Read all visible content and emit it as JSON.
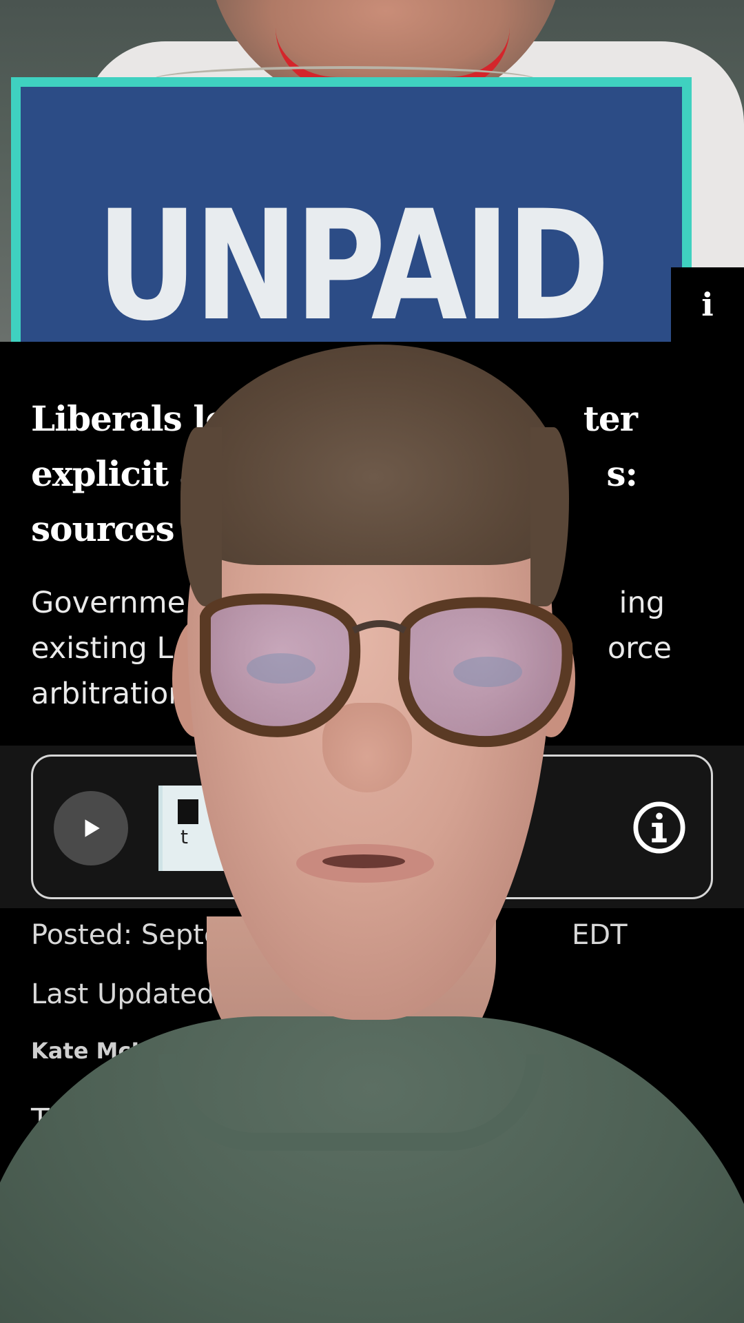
{
  "hero": {
    "sign_text": "UNPAID",
    "info_tab_label": "i"
  },
  "article": {
    "headline_lines": [
      "Liberals lo",
      "explicit a",
      "sources"
    ],
    "headline_right_fragments": [
      "ter",
      "s:"
    ],
    "summary_lines": [
      "Governme",
      "existing L",
      "arbitration"
    ],
    "summary_right_fragments": [
      "ing",
      "orce"
    ],
    "posted": "Posted: Septe",
    "posted_right": "EDT",
    "last_updated": "Last Updated:",
    "author": "Kate McKenn",
    "body_start": "Th"
  },
  "audio_player": {
    "play_icon": "play-icon",
    "info_icon": "info-circle-icon",
    "thumb_text": "t"
  },
  "colors": {
    "background": "#000000",
    "sign_blue": "#2c4c86",
    "sign_border": "#3fd1c0",
    "audio_band": "#151515",
    "text_primary": "#ffffff"
  }
}
